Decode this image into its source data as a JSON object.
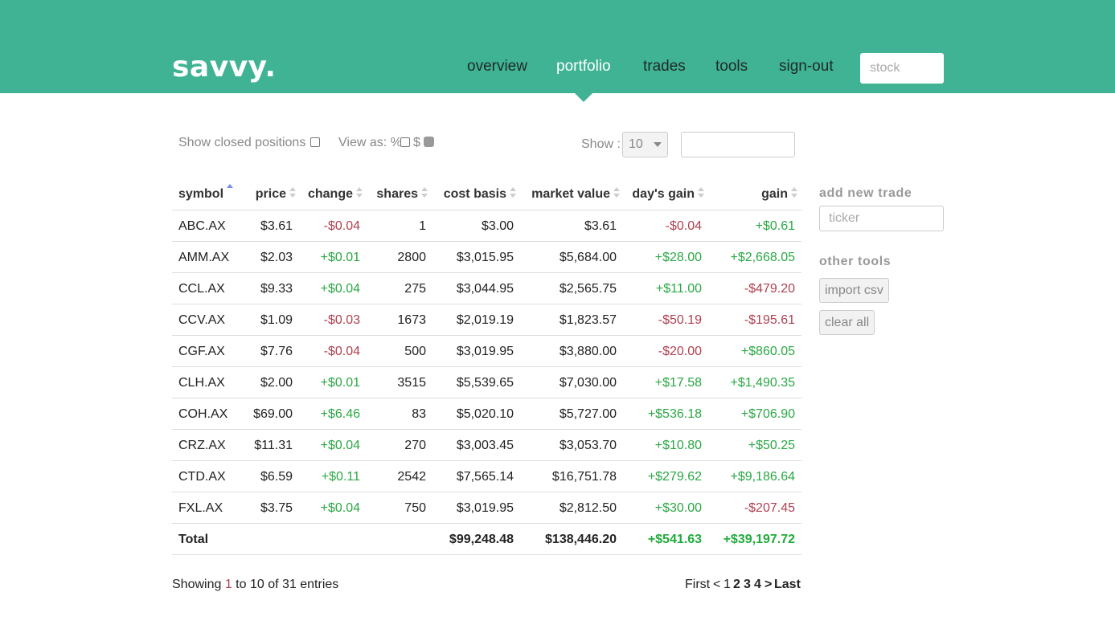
{
  "brand": {
    "logo": "savvy."
  },
  "nav": {
    "items": [
      {
        "label": "overview",
        "active": false
      },
      {
        "label": "portfolio",
        "active": true
      },
      {
        "label": "trades",
        "active": false
      },
      {
        "label": "tools",
        "active": false
      },
      {
        "label": "sign-out",
        "active": false
      }
    ],
    "search_placeholder": "stock"
  },
  "controls": {
    "show_closed_label": "Show closed positions",
    "show_closed_checked": false,
    "view_as_label": "View as: %",
    "view_as_percent_checked": false,
    "view_as_dollar_label": "$",
    "view_as_dollar_checked": true,
    "show_label": "Show :",
    "show_value": "10",
    "filter_value": ""
  },
  "table": {
    "columns": [
      "symbol",
      "price",
      "change",
      "shares",
      "cost basis",
      "market value",
      "day's gain",
      "gain"
    ],
    "sorted_column": "symbol",
    "rows": [
      {
        "symbol": "ABC.AX",
        "price": "$3.61",
        "change": "-$0.04",
        "shares": "1",
        "cost_basis": "$3.00",
        "market_value": "$3.61",
        "days_gain": "-$0.04",
        "gain": "+$0.61"
      },
      {
        "symbol": "AMM.AX",
        "price": "$2.03",
        "change": "+$0.01",
        "shares": "2800",
        "cost_basis": "$3,015.95",
        "market_value": "$5,684.00",
        "days_gain": "+$28.00",
        "gain": "+$2,668.05"
      },
      {
        "symbol": "CCL.AX",
        "price": "$9.33",
        "change": "+$0.04",
        "shares": "275",
        "cost_basis": "$3,044.95",
        "market_value": "$2,565.75",
        "days_gain": "+$11.00",
        "gain": "-$479.20"
      },
      {
        "symbol": "CCV.AX",
        "price": "$1.09",
        "change": "-$0.03",
        "shares": "1673",
        "cost_basis": "$2,019.19",
        "market_value": "$1,823.57",
        "days_gain": "-$50.19",
        "gain": "-$195.61"
      },
      {
        "symbol": "CGF.AX",
        "price": "$7.76",
        "change": "-$0.04",
        "shares": "500",
        "cost_basis": "$3,019.95",
        "market_value": "$3,880.00",
        "days_gain": "-$20.00",
        "gain": "+$860.05"
      },
      {
        "symbol": "CLH.AX",
        "price": "$2.00",
        "change": "+$0.01",
        "shares": "3515",
        "cost_basis": "$5,539.65",
        "market_value": "$7,030.00",
        "days_gain": "+$17.58",
        "gain": "+$1,490.35"
      },
      {
        "symbol": "COH.AX",
        "price": "$69.00",
        "change": "+$6.46",
        "shares": "83",
        "cost_basis": "$5,020.10",
        "market_value": "$5,727.00",
        "days_gain": "+$536.18",
        "gain": "+$706.90"
      },
      {
        "symbol": "CRZ.AX",
        "price": "$11.31",
        "change": "+$0.04",
        "shares": "270",
        "cost_basis": "$3,003.45",
        "market_value": "$3,053.70",
        "days_gain": "+$10.80",
        "gain": "+$50.25"
      },
      {
        "symbol": "CTD.AX",
        "price": "$6.59",
        "change": "+$0.11",
        "shares": "2542",
        "cost_basis": "$7,565.14",
        "market_value": "$16,751.78",
        "days_gain": "+$279.62",
        "gain": "+$9,186.64"
      },
      {
        "symbol": "FXL.AX",
        "price": "$3.75",
        "change": "+$0.04",
        "shares": "750",
        "cost_basis": "$3,019.95",
        "market_value": "$2,812.50",
        "days_gain": "+$30.00",
        "gain": "-$207.45"
      }
    ],
    "total": {
      "label": "Total",
      "cost_basis": "$99,248.48",
      "market_value": "$138,446.20",
      "days_gain": "+$541.63",
      "gain": "+$39,197.72"
    }
  },
  "footer": {
    "showing_prefix": "Showing ",
    "showing_start": "1",
    "showing_middle": " to 10 of 31 entries",
    "pager": {
      "first": "First",
      "prev": "<",
      "current": "1",
      "pages": [
        "2",
        "3",
        "4"
      ],
      "next": ">",
      "last": "Last"
    }
  },
  "sidebar": {
    "add_trade_heading": "add new trade",
    "ticker_placeholder": "ticker",
    "other_tools_heading": "other tools",
    "import_label": "import csv",
    "clear_label": "clear all"
  },
  "colors": {
    "header": "#3fb394",
    "negative": "#b04050",
    "positive": "#2aa844",
    "muted": "#888888"
  }
}
